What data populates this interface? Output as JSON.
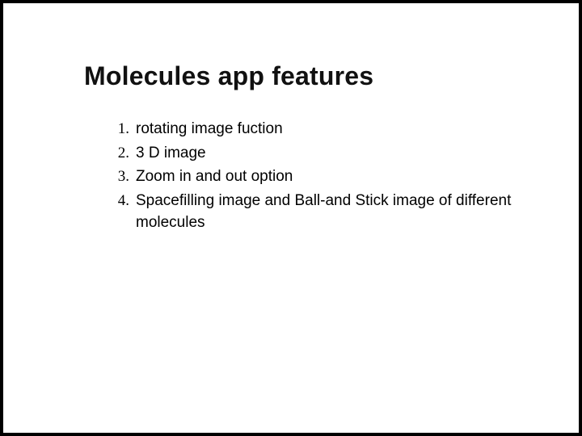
{
  "title": "Molecules app features",
  "items": [
    {
      "num": "1.",
      "text": "rotating image fuction"
    },
    {
      "num": "2.",
      "text": "3 D image"
    },
    {
      "num": "3.",
      "text": "Zoom in and out option"
    },
    {
      "num": "4.",
      "text": "Spacefilling image and Ball-and Stick image of different molecules"
    }
  ]
}
